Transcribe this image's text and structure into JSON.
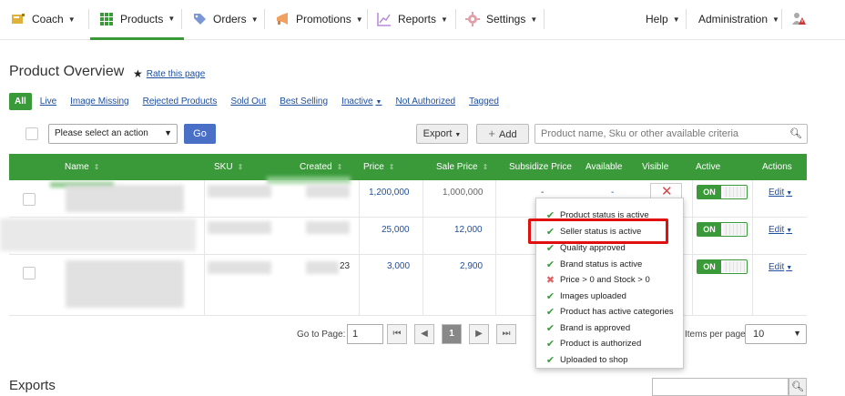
{
  "nav": {
    "items": [
      {
        "label": "Coach",
        "icon": "coach-icon"
      },
      {
        "label": "Products",
        "icon": "grid-icon"
      },
      {
        "label": "Orders",
        "icon": "tag-icon"
      },
      {
        "label": "Promotions",
        "icon": "megaphone-icon"
      },
      {
        "label": "Reports",
        "icon": "chart-icon"
      },
      {
        "label": "Settings",
        "icon": "gear-icon"
      }
    ],
    "help": "Help",
    "admin": "Administration"
  },
  "page": {
    "title": "Product Overview",
    "rate": "Rate this page"
  },
  "filters": {
    "all": "All",
    "items": [
      "Live",
      "Image Missing",
      "Rejected Products",
      "Sold Out",
      "Best Selling",
      "Inactive",
      "Not Authorized",
      "Tagged"
    ]
  },
  "toolbar": {
    "action_placeholder": "Please select an action",
    "go": "Go",
    "export": "Export",
    "add": "Add",
    "search_placeholder": "Product name, Sku or other available criteria"
  },
  "table": {
    "headers": [
      "Name",
      "SKU",
      "Created",
      "Price",
      "Sale Price",
      "Subsidize Price",
      "Available",
      "Visible",
      "Active",
      "Actions"
    ],
    "rows": [
      {
        "created_tail": "",
        "price": "1,200,000",
        "sale_price": "1,000,000",
        "subsidize": "-",
        "available": "-",
        "active": "ON",
        "action": "Edit"
      },
      {
        "created_tail": "",
        "price": "25,000",
        "sale_price": "12,000",
        "subsidize": "",
        "available": "",
        "active": "ON",
        "action": "Edit"
      },
      {
        "created_tail": "23",
        "price": "3,000",
        "sale_price": "2,900",
        "subsidize": "",
        "available": "",
        "active": "ON",
        "action": "Edit"
      }
    ]
  },
  "popover": {
    "items": [
      {
        "label": "Product status is active",
        "ok": true
      },
      {
        "label": "Seller status is active",
        "ok": true
      },
      {
        "label": "Quality approved",
        "ok": true
      },
      {
        "label": "Brand status is active",
        "ok": true
      },
      {
        "label": "Price > 0 and Stock > 0",
        "ok": false
      },
      {
        "label": "Images uploaded",
        "ok": true
      },
      {
        "label": "Product has active categories",
        "ok": true
      },
      {
        "label": "Brand is approved",
        "ok": true
      },
      {
        "label": "Product is authorized",
        "ok": true
      },
      {
        "label": "Uploaded to shop",
        "ok": true
      }
    ]
  },
  "pager": {
    "go_label": "Go to Page:",
    "page_value": "1",
    "current": "1",
    "ipp_label": "Items per page:",
    "ipp_value": "10"
  },
  "exports": {
    "title": "Exports"
  },
  "colors": {
    "accent": "#3a9a3a",
    "link": "#1e4fa0",
    "highlight": "#e01010"
  }
}
